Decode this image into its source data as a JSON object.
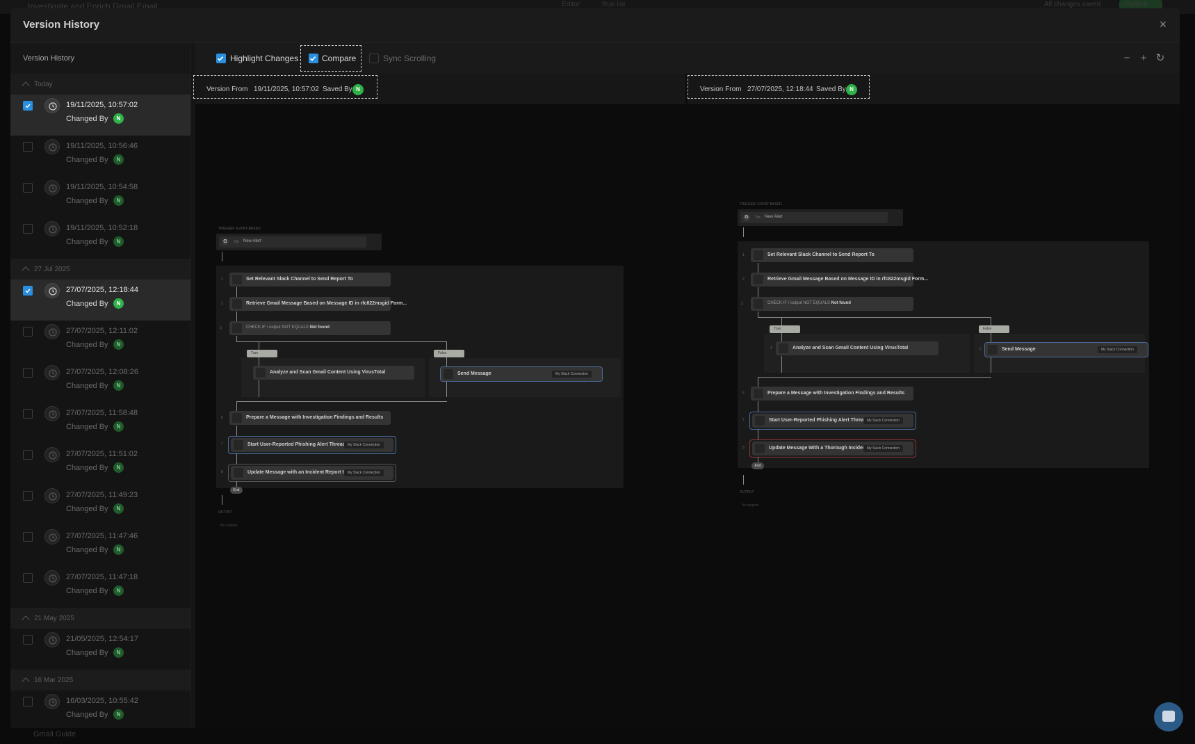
{
  "background": {
    "page_title": "Investigate and Enrich Gmail Email",
    "btn_editor": "Editor",
    "btn_runlist": "Run list",
    "status": "All changes saved",
    "publish": "Publish",
    "bottom_item": "Gmail Guide"
  },
  "modal": {
    "title": "Version History",
    "close_icon": "×"
  },
  "sidebar": {
    "title": "Version History",
    "changed_by_label": "Changed By",
    "avatar_initial": "N",
    "groups": [
      {
        "label": "Today",
        "items": [
          {
            "time": "19/11/2025, 10:57:02",
            "selected": true
          },
          {
            "time": "19/11/2025, 10:56:46",
            "selected": false
          },
          {
            "time": "19/11/2025, 10:54:58",
            "selected": false
          },
          {
            "time": "19/11/2025, 10:52:18",
            "selected": false
          }
        ]
      },
      {
        "label": "27 Jul 2025",
        "items": [
          {
            "time": "27/07/2025, 12:18:44",
            "selected": true
          },
          {
            "time": "27/07/2025, 12:11:02",
            "selected": false
          },
          {
            "time": "27/07/2025, 12:08:26",
            "selected": false
          },
          {
            "time": "27/07/2025, 11:58:48",
            "selected": false
          },
          {
            "time": "27/07/2025, 11:51:02",
            "selected": false
          },
          {
            "time": "27/07/2025, 11:49:23",
            "selected": false
          },
          {
            "time": "27/07/2025, 11:47:46",
            "selected": false
          },
          {
            "time": "27/07/2025, 11:47:18",
            "selected": false
          }
        ]
      },
      {
        "label": "21 May 2025",
        "items": [
          {
            "time": "21/05/2025, 12:54:17",
            "selected": false
          }
        ]
      },
      {
        "label": "16 Mar 2025",
        "items": [
          {
            "time": "16/03/2025, 10:55:42",
            "selected": false
          }
        ]
      }
    ]
  },
  "toolbar": {
    "highlight_changes": "Highlight Changes",
    "highlight_checked": true,
    "compare": "Compare",
    "compare_checked": true,
    "sync_scrolling": "Sync Scrolling",
    "sync_checked": false,
    "zoom_out": "−",
    "zoom_in": "+",
    "reset_icon": "↻"
  },
  "left_version": {
    "version_from_label": "Version From",
    "date": "19/11/2025, 10:57:02",
    "saved_by_label": "Saved By",
    "avatar": "N"
  },
  "right_version": {
    "version_from_label": "Version From",
    "date": "27/07/2025, 12:18:44",
    "saved_by_label": "Saved By",
    "avatar": "N"
  },
  "flow": {
    "trigger_label": "TRIGGER: EVENT-BASED",
    "trigger_on": "On",
    "trigger_name": "New Alert",
    "trigger_icon": "G",
    "output_label": "OUTPUT",
    "no_outputs": "No outputs",
    "check_if": "CHECK IF",
    "check_var": "/ output",
    "not_equals": "NOT EQUALS",
    "not_found": "Not found",
    "true_label": "True",
    "false_label": "False",
    "end_label": "End",
    "slack_conn": "My Slack Connection",
    "step_set_channel": "Set Relevant Slack Channel to Send Report To",
    "step_retrieve": "Retrieve Gmail Message Based on Message ID in rfc822msgid Form...",
    "step_analyze": "Analyze and Scan Gmail Content Using VirusTotal",
    "step_send": "Send Message",
    "step_prepare": "Prepare a Message with Investigation Findings and Results",
    "step_start_thread": "Start User-Reported Phishing Alert Thread",
    "step_update_left": "Update Message with an Incident Report to...",
    "step_update_right": "Update Message With a Thorough Incident ..."
  }
}
